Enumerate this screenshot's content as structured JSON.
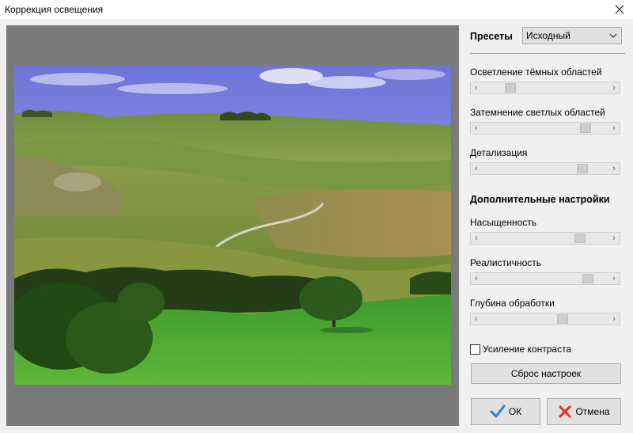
{
  "window": {
    "title": "Коррекция освещения",
    "close_icon": "close-icon"
  },
  "presets": {
    "label": "Пресеты",
    "selected": "Исходный"
  },
  "sliders": [
    {
      "label": "Осветление тёмных областей",
      "value_fraction": 0.2
    },
    {
      "label": "Затемнение светлых областей",
      "value_fraction": 0.85
    },
    {
      "label": "Детализация",
      "value_fraction": 0.82
    }
  ],
  "advanced": {
    "title": "Дополнительные настройки",
    "sliders": [
      {
        "label": "Насыщенность",
        "value_fraction": 0.8
      },
      {
        "label": "Реалистичность",
        "value_fraction": 0.87
      },
      {
        "label": "Глубина обработки",
        "value_fraction": 0.65
      }
    ]
  },
  "contrast_checkbox": {
    "label": "Усиление контраста",
    "checked": false
  },
  "buttons": {
    "reset": "Сброс настроек",
    "ok": "ОК",
    "cancel": "Отмена"
  },
  "colors": {
    "ok_check": "#2f7fd8",
    "cancel_x": "#e0392e",
    "preview_bg": "#7a7a7a"
  }
}
